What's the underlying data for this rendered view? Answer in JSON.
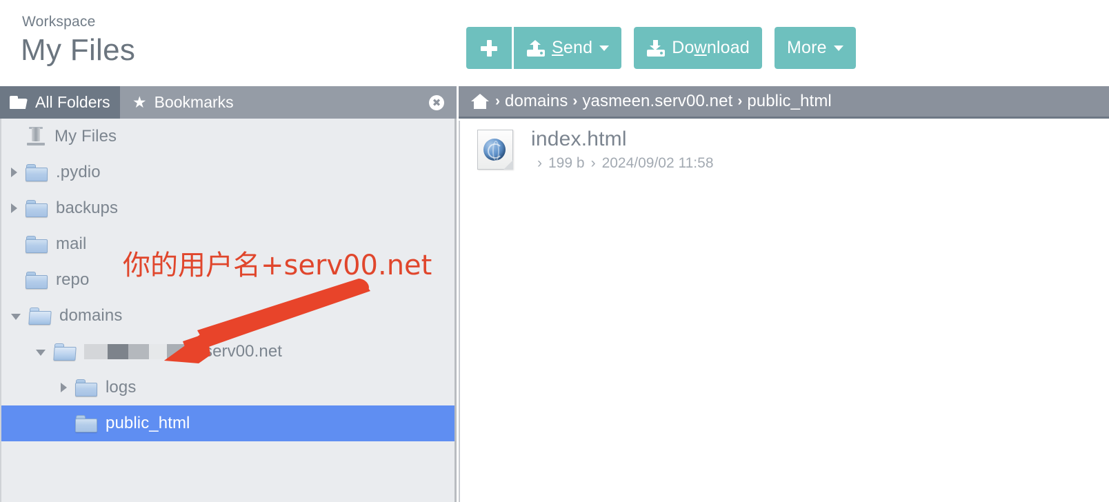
{
  "header": {
    "workspace_label": "Workspace",
    "title": "My Files"
  },
  "toolbar": {
    "new_label": "",
    "new_icon": "plus-icon",
    "send_label_pre": "",
    "send_label": "Send",
    "send_accesskey": "S",
    "send_rest": "end",
    "download_pre": "Do",
    "download_accesskey": "w",
    "download_rest": "nload",
    "download_label": "Download",
    "more_label": "More",
    "accent_color": "#6ec0be"
  },
  "left_panel": {
    "tabs": [
      {
        "label": "All Folders",
        "icon": "folder-open-icon",
        "active": true
      },
      {
        "label": "Bookmarks",
        "icon": "star-icon",
        "active": false
      }
    ],
    "close_icon": "close-icon",
    "selection_color": "#5f8ef2",
    "tree": [
      {
        "label": "My Files",
        "icon": "drive-icon",
        "twist": "none",
        "indent": 0,
        "selected": false
      },
      {
        "label": ".pydio",
        "icon": "folder-icon",
        "twist": "closed",
        "indent": 1,
        "selected": false
      },
      {
        "label": "backups",
        "icon": "folder-icon",
        "twist": "closed",
        "indent": 1,
        "selected": false
      },
      {
        "label": "mail",
        "icon": "folder-icon",
        "twist": "none",
        "indent": 1,
        "selected": false
      },
      {
        "label": "repo",
        "icon": "folder-icon",
        "twist": "none",
        "indent": 1,
        "selected": false
      },
      {
        "label": "domains",
        "icon": "folder-open-icon",
        "twist": "open",
        "indent": 1,
        "selected": false
      },
      {
        "label": "serv00.net",
        "icon": "folder-open-icon",
        "twist": "open",
        "indent": 2,
        "selected": false,
        "redacted_prefix": true
      },
      {
        "label": "logs",
        "icon": "folder-icon",
        "twist": "closed",
        "indent": 3,
        "selected": false
      },
      {
        "label": "public_html",
        "icon": "folder-icon",
        "twist": "none",
        "indent": 3,
        "selected": true
      }
    ]
  },
  "right_panel": {
    "breadcrumb": {
      "home_icon": "home-icon",
      "separator": "›",
      "crumbs": [
        "domains",
        "yasmeen.serv00.net",
        "public_html"
      ]
    },
    "files": [
      {
        "name": "index.html",
        "icon": "html-file-icon",
        "size": "199 b",
        "modified": "2024/09/02 11:58",
        "separator": "›"
      }
    ]
  },
  "annotation": {
    "text": "你的用户名+serv00.net",
    "color": "#e0462c",
    "arrow": "red-arrow-pointing-to-domain-folder"
  }
}
